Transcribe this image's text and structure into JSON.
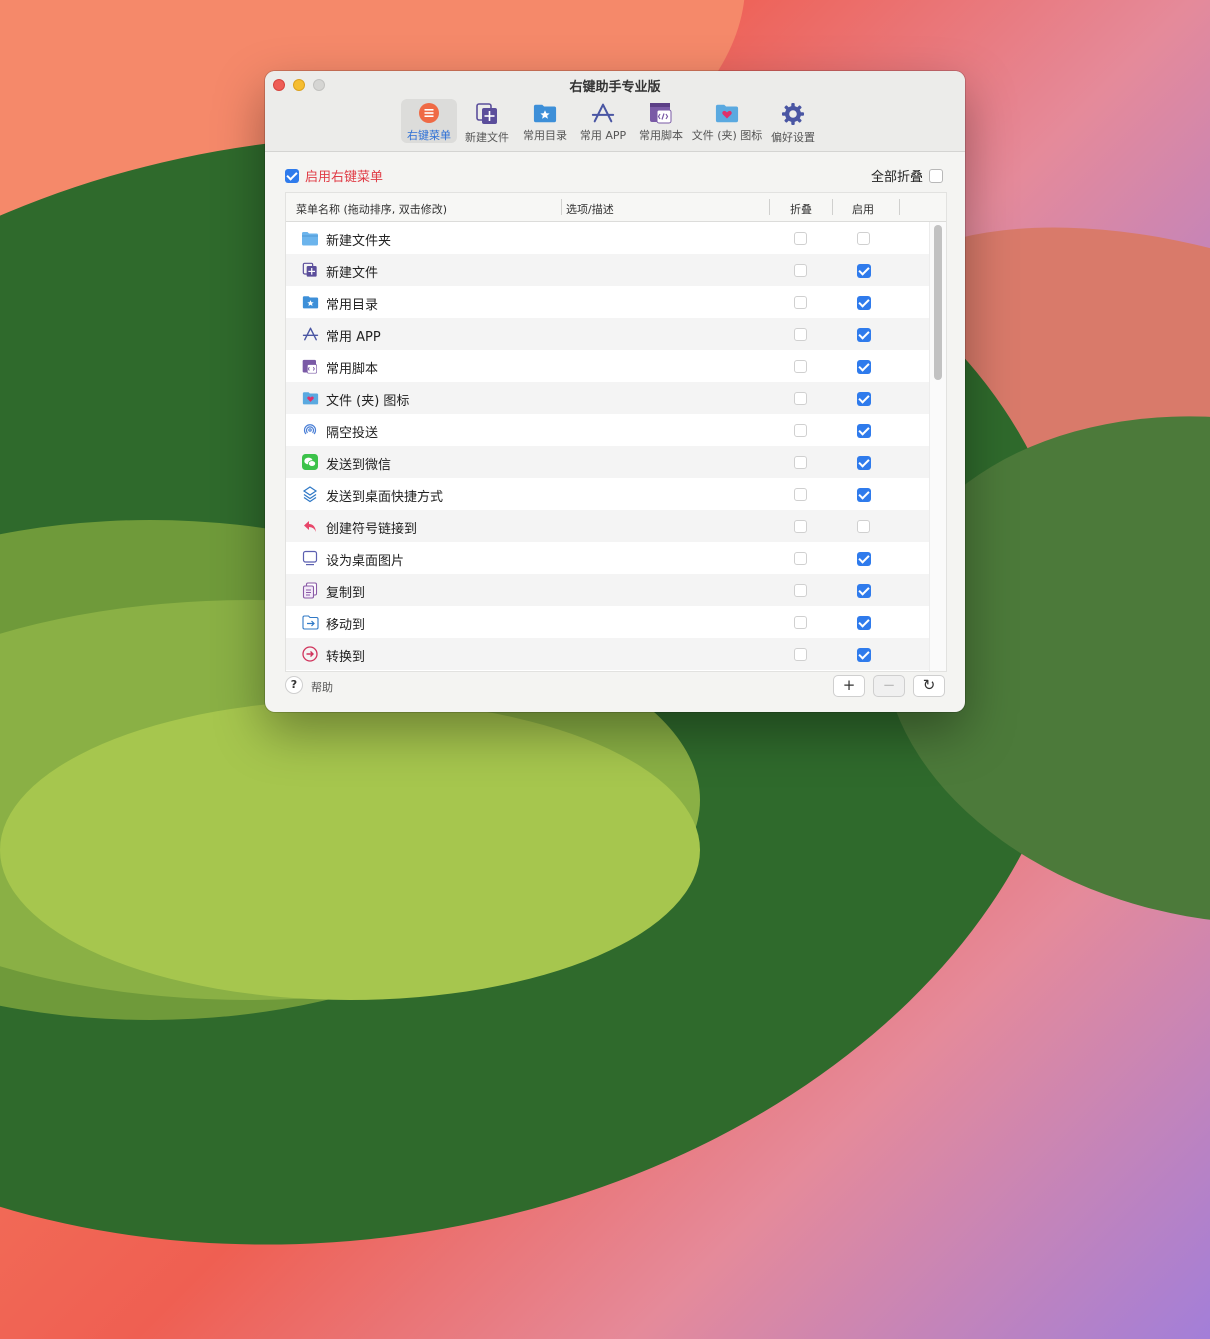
{
  "window": {
    "title": "右键助手专业版"
  },
  "toolbar": {
    "items": [
      {
        "label": "右键菜单",
        "icon": "menu-icon",
        "active": true
      },
      {
        "label": "新建文件",
        "icon": "new-file-icon"
      },
      {
        "label": "常用目录",
        "icon": "folder-star-icon"
      },
      {
        "label": "常用 APP",
        "icon": "app-store-icon"
      },
      {
        "label": "常用脚本",
        "icon": "script-icon"
      },
      {
        "label": "文件 (夹) 图标",
        "icon": "folder-heart-icon"
      },
      {
        "label": "偏好设置",
        "icon": "gear-icon"
      }
    ]
  },
  "main": {
    "enable_label": "启用右键菜单",
    "enable_checked": true,
    "fold_all_label": "全部折叠",
    "fold_all_checked": false
  },
  "table": {
    "columns": [
      "菜单名称 (拖动排序, 双击修改)",
      "选项/描述",
      "折叠",
      "启用"
    ],
    "rows": [
      {
        "name": "新建文件夹",
        "icon": "folder-icon",
        "fold": false,
        "enabled": false
      },
      {
        "name": "新建文件",
        "icon": "new-file-icon",
        "fold": false,
        "enabled": true
      },
      {
        "name": "常用目录",
        "icon": "folder-star-icon",
        "fold": false,
        "enabled": true
      },
      {
        "name": "常用 APP",
        "icon": "app-store-icon",
        "fold": false,
        "enabled": true
      },
      {
        "name": "常用脚本",
        "icon": "script-icon",
        "fold": false,
        "enabled": true
      },
      {
        "name": "文件 (夹) 图标",
        "icon": "folder-heart-icon",
        "fold": false,
        "enabled": true
      },
      {
        "name": "隔空投送",
        "icon": "airdrop-icon",
        "fold": false,
        "enabled": true
      },
      {
        "name": "发送到微信",
        "icon": "wechat-icon",
        "fold": false,
        "enabled": true
      },
      {
        "name": "发送到桌面快捷方式",
        "icon": "shortcut-icon",
        "fold": false,
        "enabled": true
      },
      {
        "name": "创建符号链接到",
        "icon": "symlink-icon",
        "fold": false,
        "enabled": false
      },
      {
        "name": "设为桌面图片",
        "icon": "desktop-icon",
        "fold": false,
        "enabled": true
      },
      {
        "name": "复制到",
        "icon": "copy-icon",
        "fold": false,
        "enabled": true
      },
      {
        "name": "移动到",
        "icon": "move-icon",
        "fold": false,
        "enabled": true
      },
      {
        "name": "转换到",
        "icon": "convert-icon",
        "fold": false,
        "enabled": true
      }
    ]
  },
  "footer": {
    "help_symbol": "?",
    "help_label": "帮助",
    "add_symbol": "+",
    "remove_symbol": "−",
    "refresh_symbol": "↻"
  }
}
